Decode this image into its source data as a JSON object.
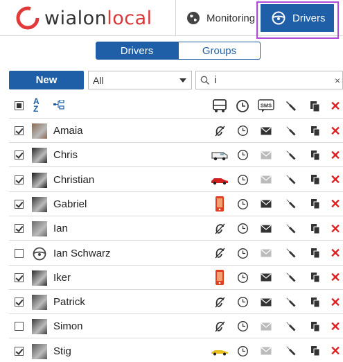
{
  "app": {
    "logo_text_main": "wialon",
    "logo_text_accent": "local",
    "tabs": [
      {
        "label": "Monitoring",
        "icon": "globe-icon"
      },
      {
        "label": "Drivers",
        "icon": "steering-wheel-icon",
        "active": true
      }
    ]
  },
  "segmented": {
    "items": [
      "Drivers",
      "Groups"
    ],
    "active": "Drivers"
  },
  "toolbar": {
    "new_label": "New",
    "filter_value": "All",
    "search_value": "i",
    "clear_label": "×"
  },
  "colors": {
    "accent": "#1e5fa8",
    "highlight": "#b04ad8",
    "delete": "#e02020"
  },
  "drivers": [
    {
      "name": "Amaia",
      "checked": true,
      "unit": "none",
      "sms": true
    },
    {
      "name": "Chris",
      "checked": true,
      "unit": "van",
      "sms": false
    },
    {
      "name": "Christian",
      "checked": true,
      "unit": "red-car",
      "sms": false
    },
    {
      "name": "Gabriel",
      "checked": true,
      "unit": "phone",
      "sms": true
    },
    {
      "name": "Ian",
      "checked": true,
      "unit": "none",
      "sms": true
    },
    {
      "name": "Ian Schwarz",
      "checked": false,
      "unit": "none",
      "sms": false
    },
    {
      "name": "Iker",
      "checked": true,
      "unit": "phone",
      "sms": true
    },
    {
      "name": "Patrick",
      "checked": true,
      "unit": "none",
      "sms": true
    },
    {
      "name": "Simon",
      "checked": false,
      "unit": "none",
      "sms": false
    },
    {
      "name": "Stig",
      "checked": true,
      "unit": "yellow-car",
      "sms": false
    }
  ]
}
